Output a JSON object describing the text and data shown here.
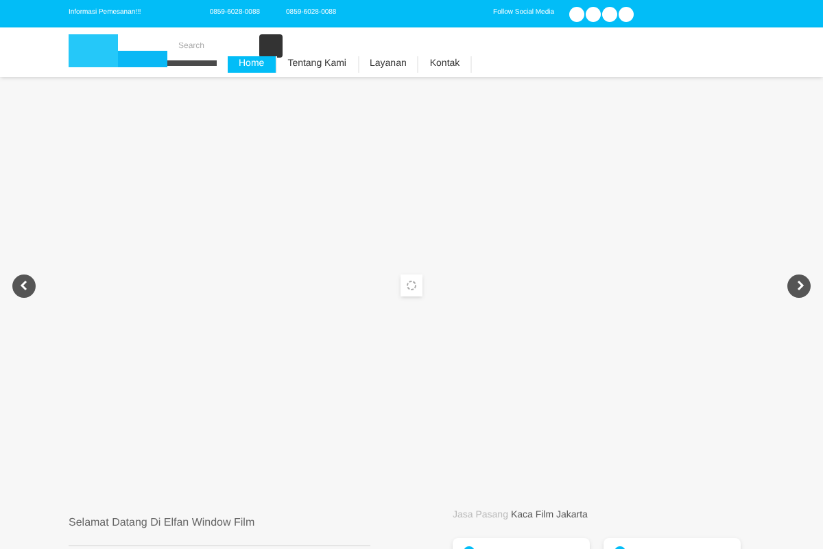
{
  "topbar": {
    "info": "Informasi Pemesanan!!!",
    "phones": [
      "0859-6028-0088",
      "0859-6028-0088"
    ],
    "social_label": "Follow Social Media"
  },
  "header": {
    "search": {
      "placeholder": "Search"
    },
    "nav": [
      {
        "label": "Home",
        "selected": true
      },
      {
        "label": "Tentang Kami",
        "selected": false
      },
      {
        "label": "Layanan",
        "selected": false
      },
      {
        "label": "Kontak",
        "selected": false
      }
    ]
  },
  "left": {
    "title": "Selamat Datang Di Elfan Window Film"
  },
  "right": {
    "title_prefix": "Jasa Pasang",
    "title_main": "Kaca Film Jakarta"
  }
}
